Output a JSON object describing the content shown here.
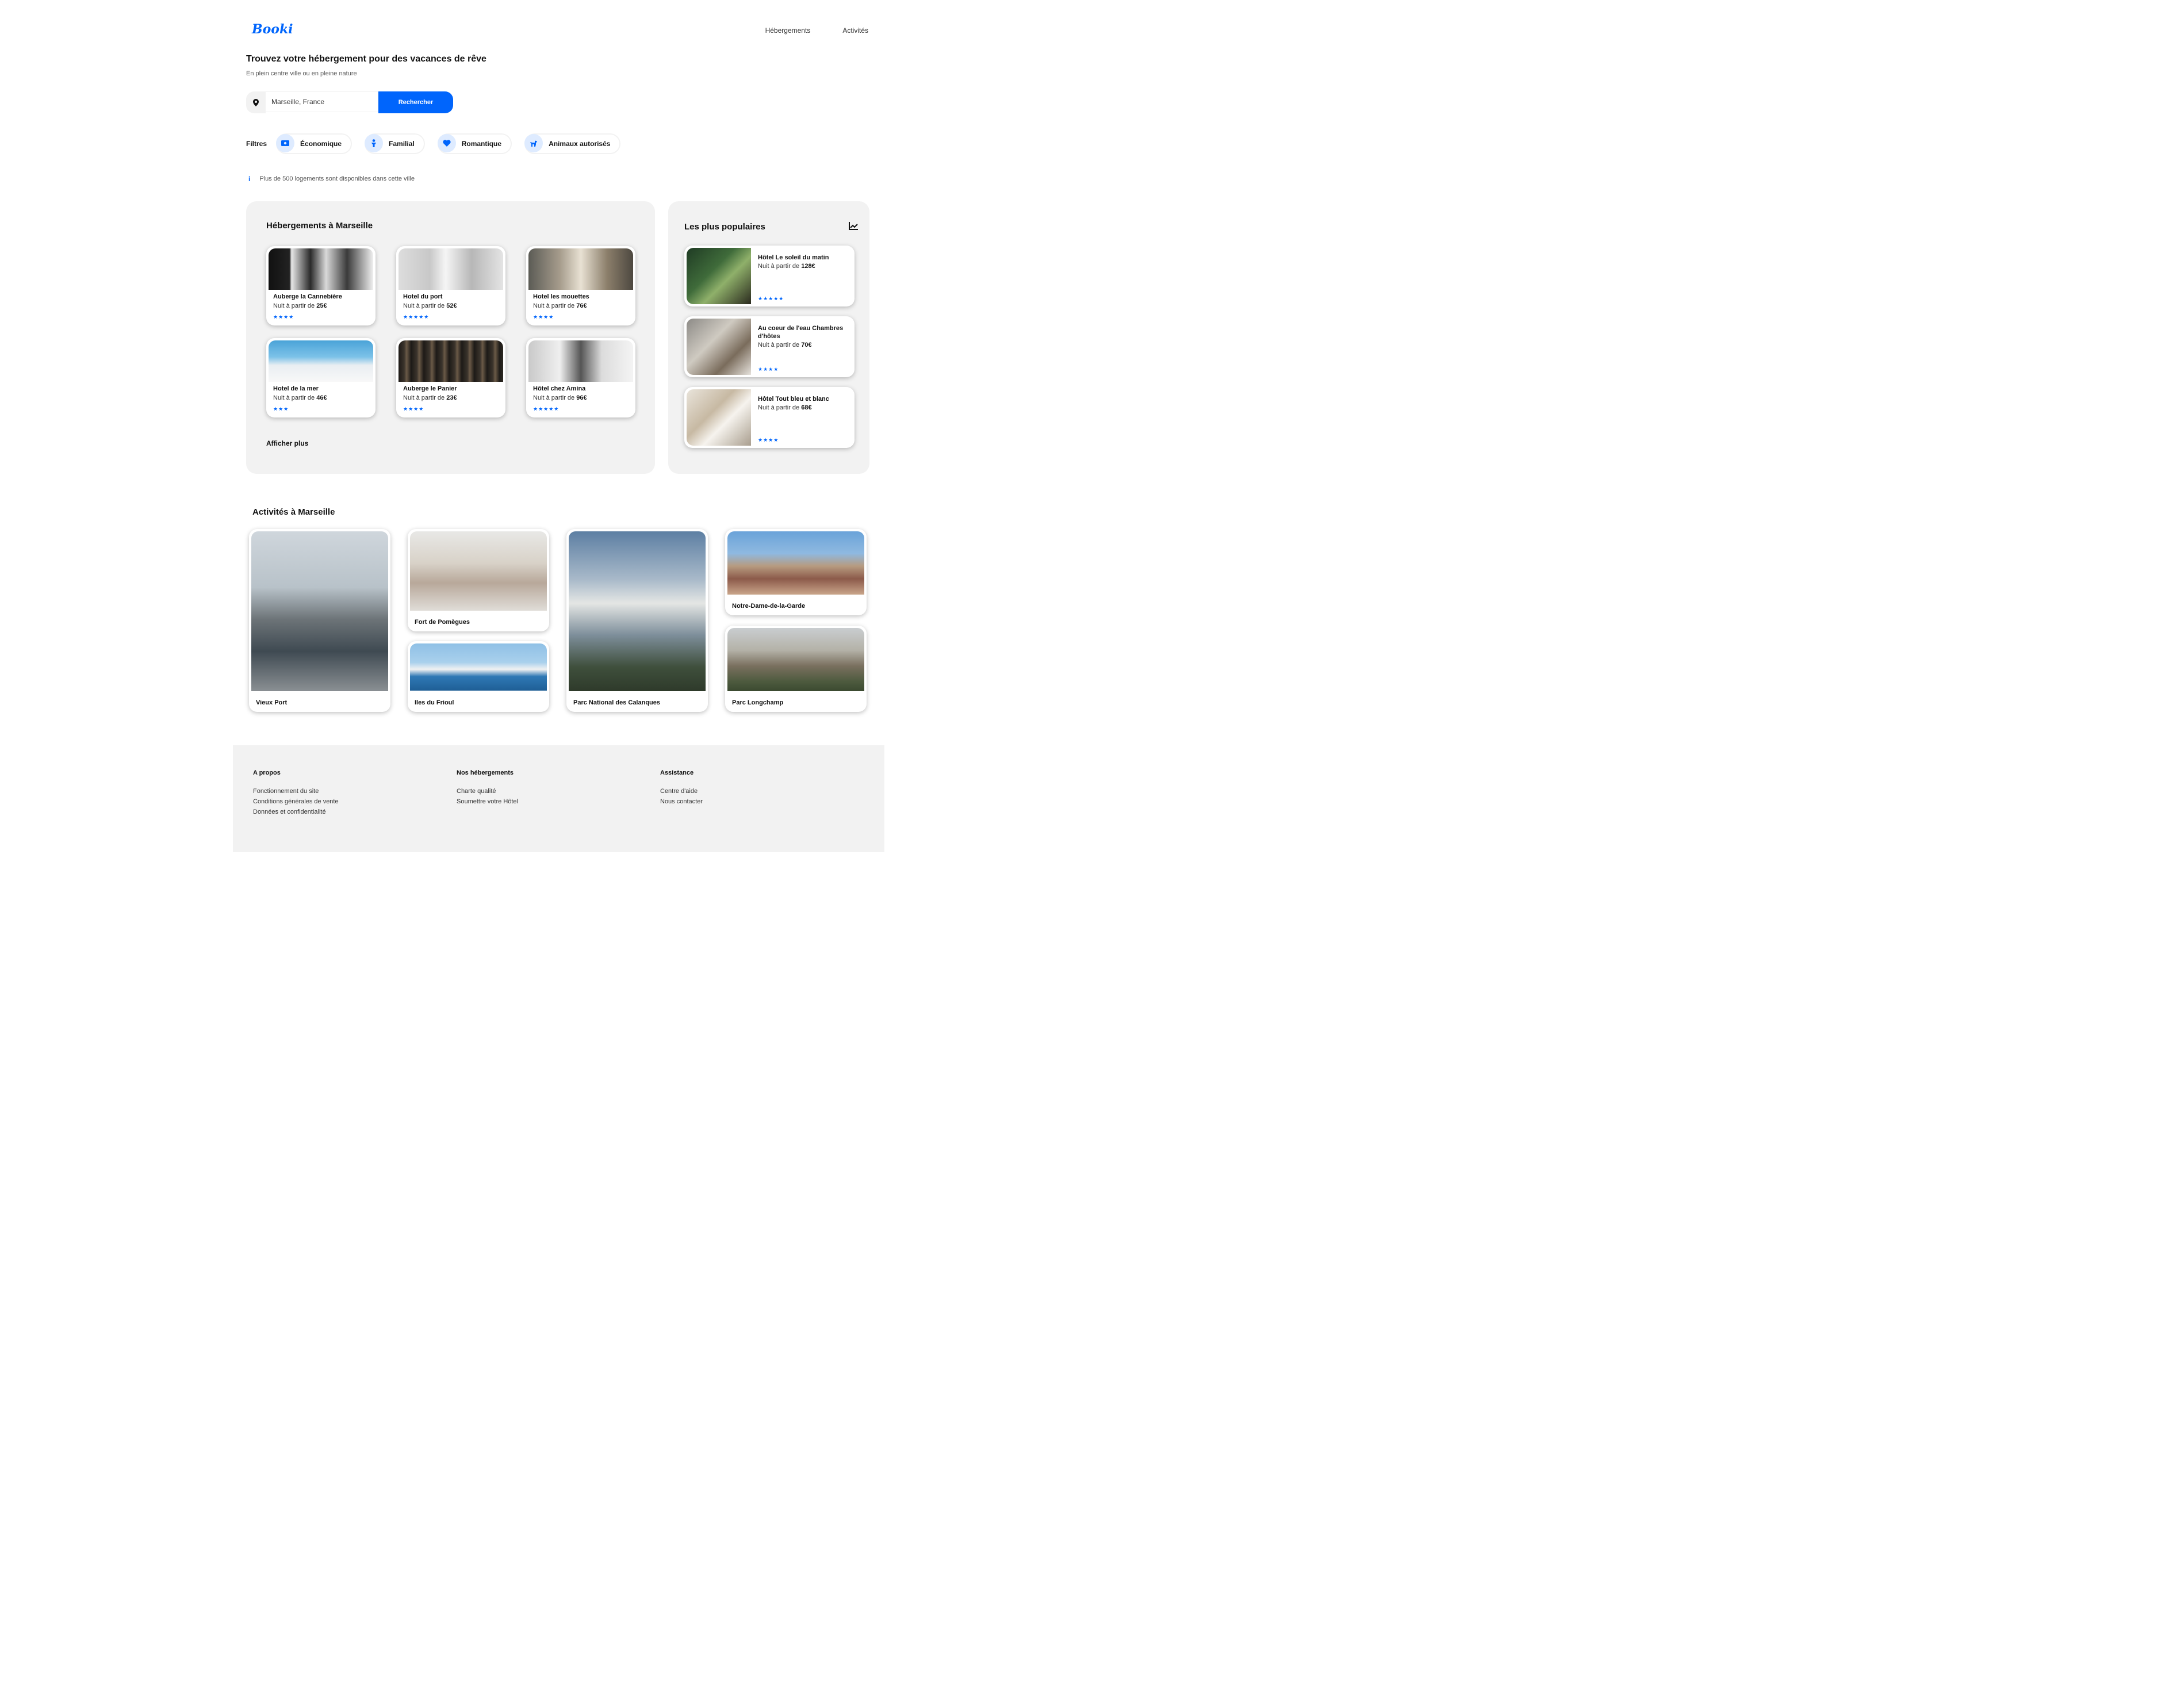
{
  "brand": {
    "logo": "Booki",
    "accent": "#0065fc"
  },
  "nav": [
    {
      "label": "Hébergements"
    },
    {
      "label": "Activités"
    }
  ],
  "hero": {
    "title": "Trouvez votre hébergement pour des vacances de rêve",
    "subtitle": "En plein centre ville ou en pleine nature",
    "search_value": "Marseille, France",
    "search_button": "Rechercher"
  },
  "filters": {
    "label": "Filtres",
    "items": [
      {
        "label": "Économique",
        "icon": "money-icon"
      },
      {
        "label": "Familial",
        "icon": "child-icon"
      },
      {
        "label": "Romantique",
        "icon": "heart-icon"
      },
      {
        "label": "Animaux autorisés",
        "icon": "dog-icon"
      }
    ]
  },
  "info": "Plus de 500 logements sont disponibles dans cette ville",
  "accommodations": {
    "title": "Hébergements à Marseille",
    "price_prefix": "Nuit à partir de ",
    "show_more": "Afficher plus",
    "items": [
      {
        "name": "Auberge la Cannebière",
        "price": "25€",
        "rating": 4
      },
      {
        "name": "Hotel du port",
        "price": "52€",
        "rating": 5
      },
      {
        "name": "Hotel les mouettes",
        "price": "76€",
        "rating": 4
      },
      {
        "name": "Hotel de la mer",
        "price": "46€",
        "rating": 3
      },
      {
        "name": "Auberge le Panier",
        "price": "23€",
        "rating": 4
      },
      {
        "name": "Hôtel chez Amina",
        "price": "96€",
        "rating": 5
      }
    ]
  },
  "popular": {
    "title": "Les plus populaires",
    "icon": "chart-trend-icon",
    "price_prefix": "Nuit à partir de ",
    "items": [
      {
        "name": "Hôtel Le soleil du matin",
        "price": "128€",
        "rating": 5
      },
      {
        "name": "Au coeur de l'eau Chambres d'hôtes",
        "price": "70€",
        "rating": 4
      },
      {
        "name": "Hôtel Tout bleu et blanc",
        "price": "68€",
        "rating": 4
      }
    ]
  },
  "activities": {
    "title": "Activités à Marseille",
    "items": [
      {
        "label": "Vieux Port"
      },
      {
        "label": "Fort de Pomègues"
      },
      {
        "label": "Iles du Frioul"
      },
      {
        "label": "Parc National des Calanques"
      },
      {
        "label": "Notre-Dame-de-la-Garde"
      },
      {
        "label": "Parc Longchamp"
      }
    ]
  },
  "footer": {
    "columns": [
      {
        "title": "A propos",
        "links": [
          "Fonctionnement du site",
          "Conditions générales de vente",
          "Données et confidentialité"
        ]
      },
      {
        "title": "Nos hébergements",
        "links": [
          "Charte qualité",
          "Soumettre votre Hôtel"
        ]
      },
      {
        "title": "Assistance",
        "links": [
          "Centre d'aide",
          "Nous contacter"
        ]
      }
    ]
  }
}
